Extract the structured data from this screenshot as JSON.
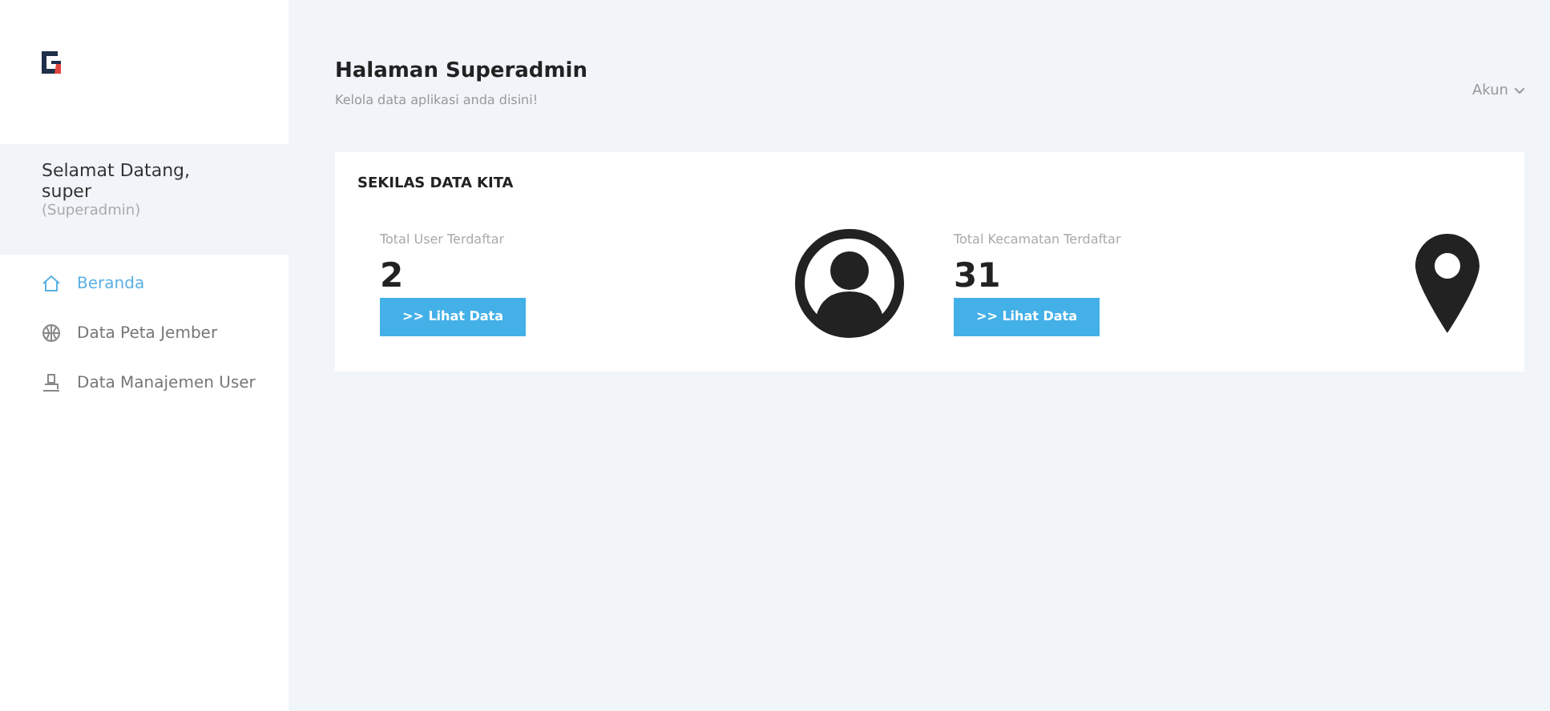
{
  "sidebar": {
    "greeting": "Selamat Datang,",
    "username": "super",
    "role": "(Superadmin)",
    "items": [
      {
        "label": "Beranda",
        "kind": "home",
        "selected": true
      },
      {
        "label": "Data Peta Jember",
        "kind": "map",
        "selected": false
      },
      {
        "label": "Data Manajemen User",
        "kind": "users",
        "selected": false
      }
    ]
  },
  "header": {
    "title": "Halaman Superadmin",
    "subtitle": "Kelola data aplikasi anda disini!",
    "account_menu": "Akun"
  },
  "panel": {
    "title": "SEKILAS DATA KITA",
    "stats": [
      {
        "label": "Total User Terdaftar",
        "value": "2",
        "button": ">> Lihat Data",
        "kind": "users"
      },
      {
        "label": "Total Kecamatan Terdaftar",
        "value": "31",
        "button": ">> Lihat Data",
        "kind": "places"
      }
    ]
  }
}
